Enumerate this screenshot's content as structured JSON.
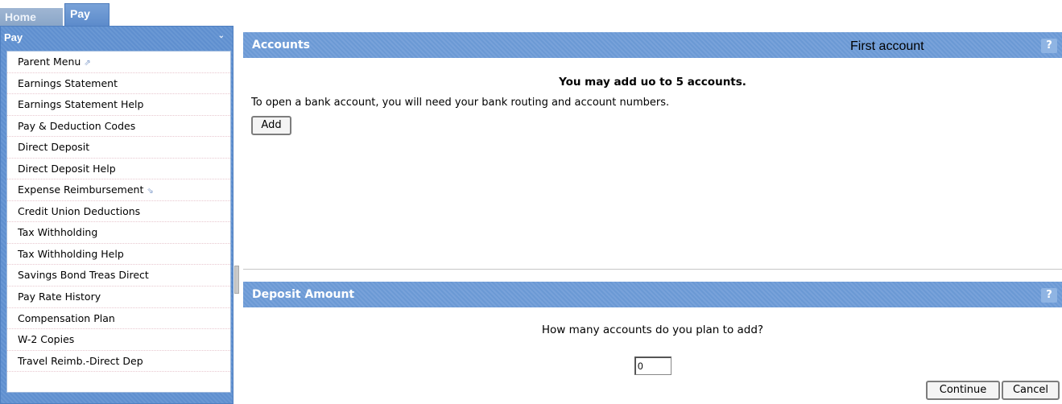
{
  "tabs": {
    "home": "Home",
    "pay": "Pay"
  },
  "sidebar": {
    "title": "Pay",
    "items": [
      {
        "label": "Parent Menu",
        "ext": "⇗"
      },
      {
        "label": "Earnings Statement"
      },
      {
        "label": "Earnings Statement Help"
      },
      {
        "label": "Pay & Deduction Codes"
      },
      {
        "label": "Direct Deposit"
      },
      {
        "label": "Direct Deposit Help"
      },
      {
        "label": "Expense Reimbursement",
        "ext": "⇘"
      },
      {
        "label": "Credit Union Deductions"
      },
      {
        "label": "Tax Withholding"
      },
      {
        "label": "Tax Withholding Help"
      },
      {
        "label": "Savings Bond Treas Direct"
      },
      {
        "label": "Pay Rate History"
      },
      {
        "label": "Compensation Plan"
      },
      {
        "label": "W-2 Copies"
      },
      {
        "label": "Travel Reimb.-Direct Dep"
      }
    ]
  },
  "accounts": {
    "title": "Accounts",
    "first_account": "First account",
    "heading": "You may add uo to 5 accounts.",
    "description": "To open a bank account, you will need your bank routing and account numbers.",
    "add_label": "Add",
    "help_label": "?"
  },
  "deposit": {
    "title": "Deposit Amount",
    "question": "How many accounts do you plan to add?",
    "count_value": "0",
    "help_label": "?",
    "continue_label": "Continue",
    "cancel_label": "Cancel"
  },
  "colors": {
    "accent": "#6b99d4",
    "sidebar": "#5f8fcf"
  }
}
